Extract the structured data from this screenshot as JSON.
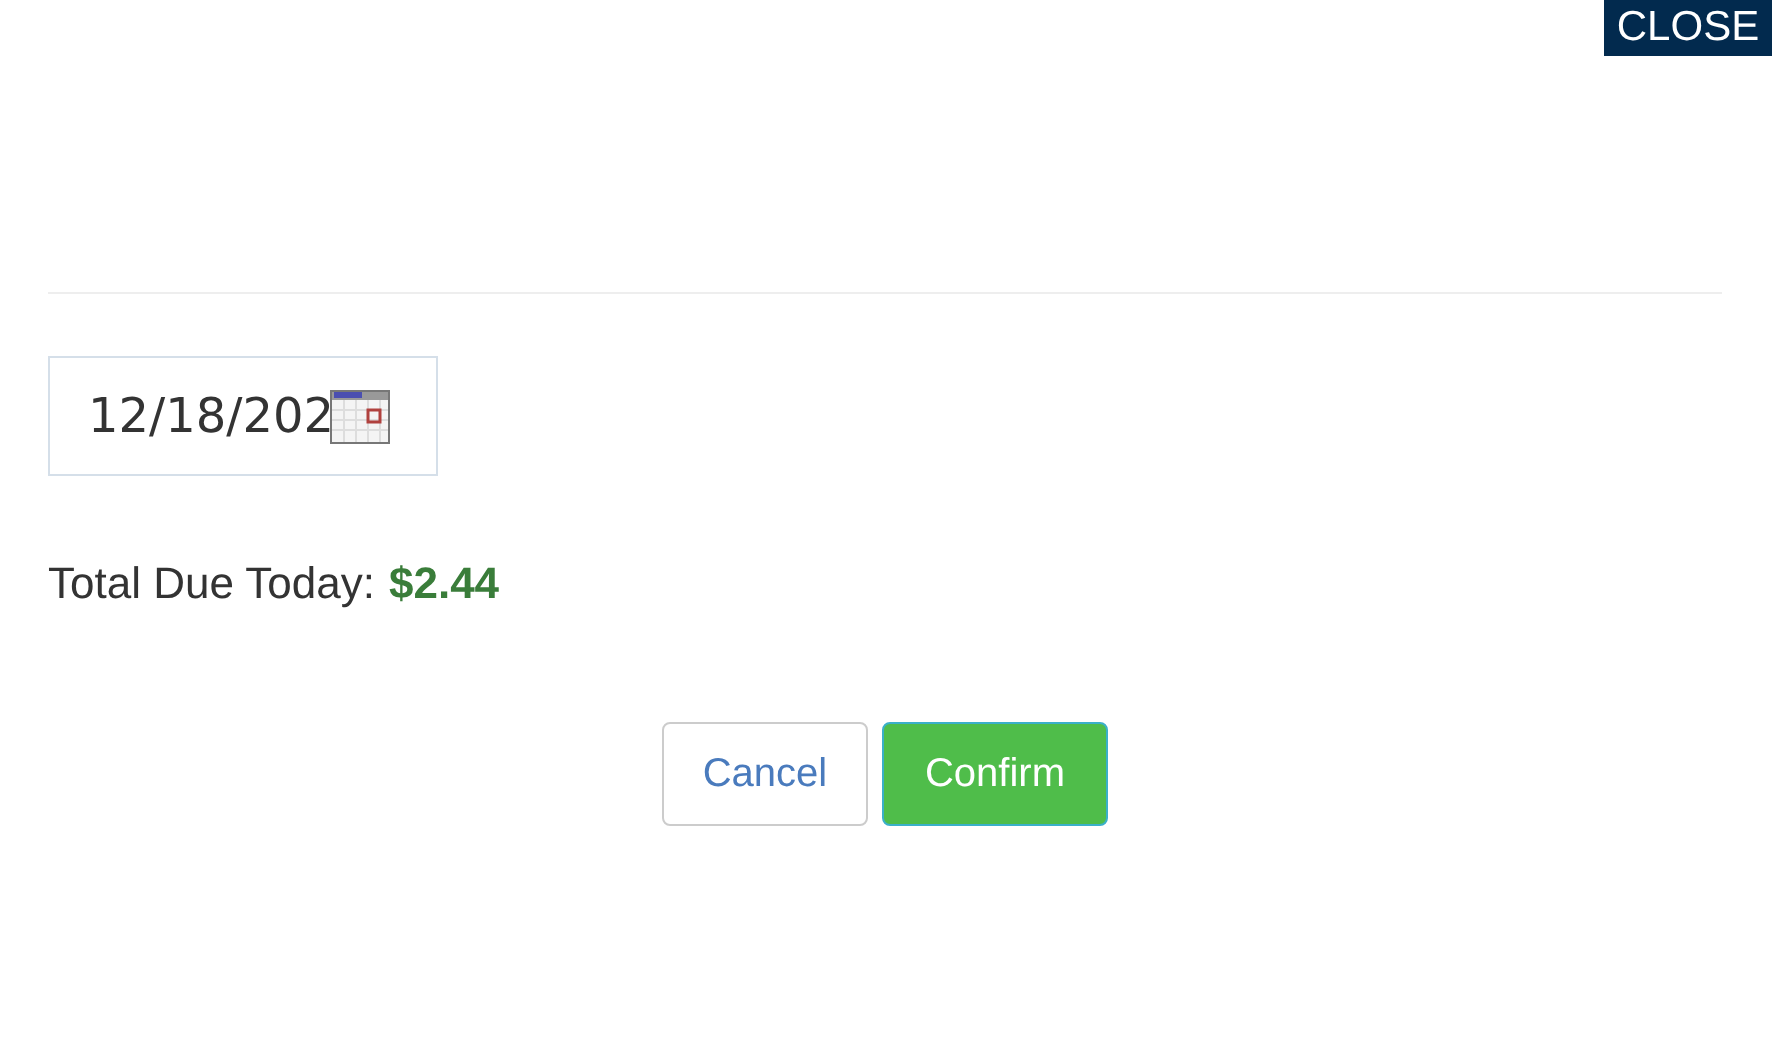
{
  "close_button": {
    "label": "CLOSE"
  },
  "date_field": {
    "value": "12/18/202"
  },
  "total": {
    "label": "Total Due Today:",
    "amount": "$2.44"
  },
  "buttons": [
    {
      "label": "Cancel",
      "kind": "secondary"
    },
    {
      "label": "Confirm",
      "kind": "primary"
    }
  ]
}
